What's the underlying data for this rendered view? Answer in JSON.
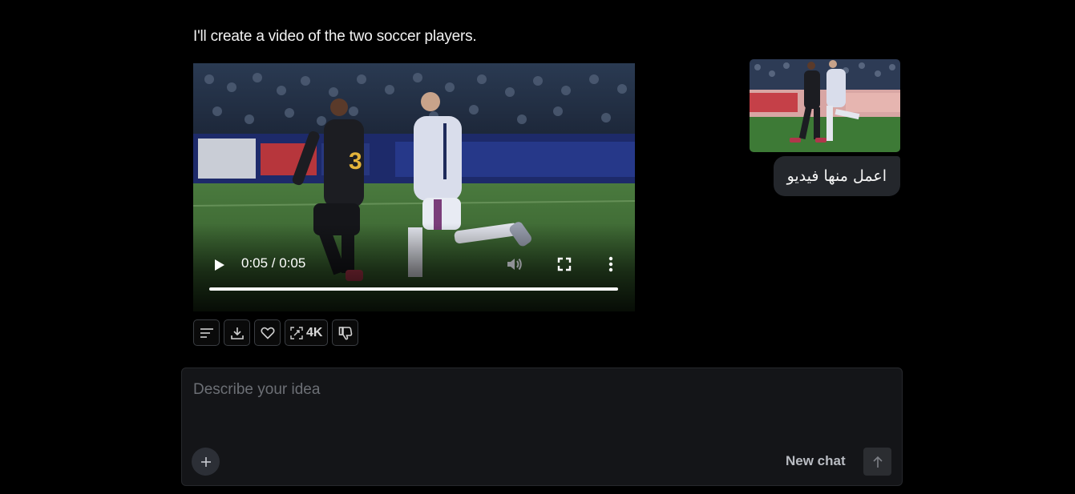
{
  "conversation": {
    "assistant_message": "I'll create a video of the two soccer players.",
    "user_message": "اعمل منها فيديو"
  },
  "video_player": {
    "current_time": "0:05",
    "duration": "0:05",
    "time_display": "0:05 / 0:05",
    "progress_fraction": 1.0,
    "icons": [
      "play-icon",
      "volume-icon",
      "fullscreen-icon",
      "more-vertical-icon"
    ]
  },
  "actions": {
    "upscale_label": "4K",
    "icons": [
      "prompt-lines-icon",
      "download-icon",
      "heart-icon",
      "upscale-icon",
      "thumbs-down-icon"
    ]
  },
  "composer": {
    "placeholder": "Describe your idea",
    "new_chat_label": "New chat",
    "icons": [
      "plus-icon",
      "arrow-up-icon"
    ]
  },
  "colors": {
    "background": "#000000",
    "bubble": "#24272c",
    "composer": "#141518",
    "pitch": "#3f6b35",
    "kit_dark": "#1c1d22",
    "kit_light": "#d9ddeb"
  }
}
